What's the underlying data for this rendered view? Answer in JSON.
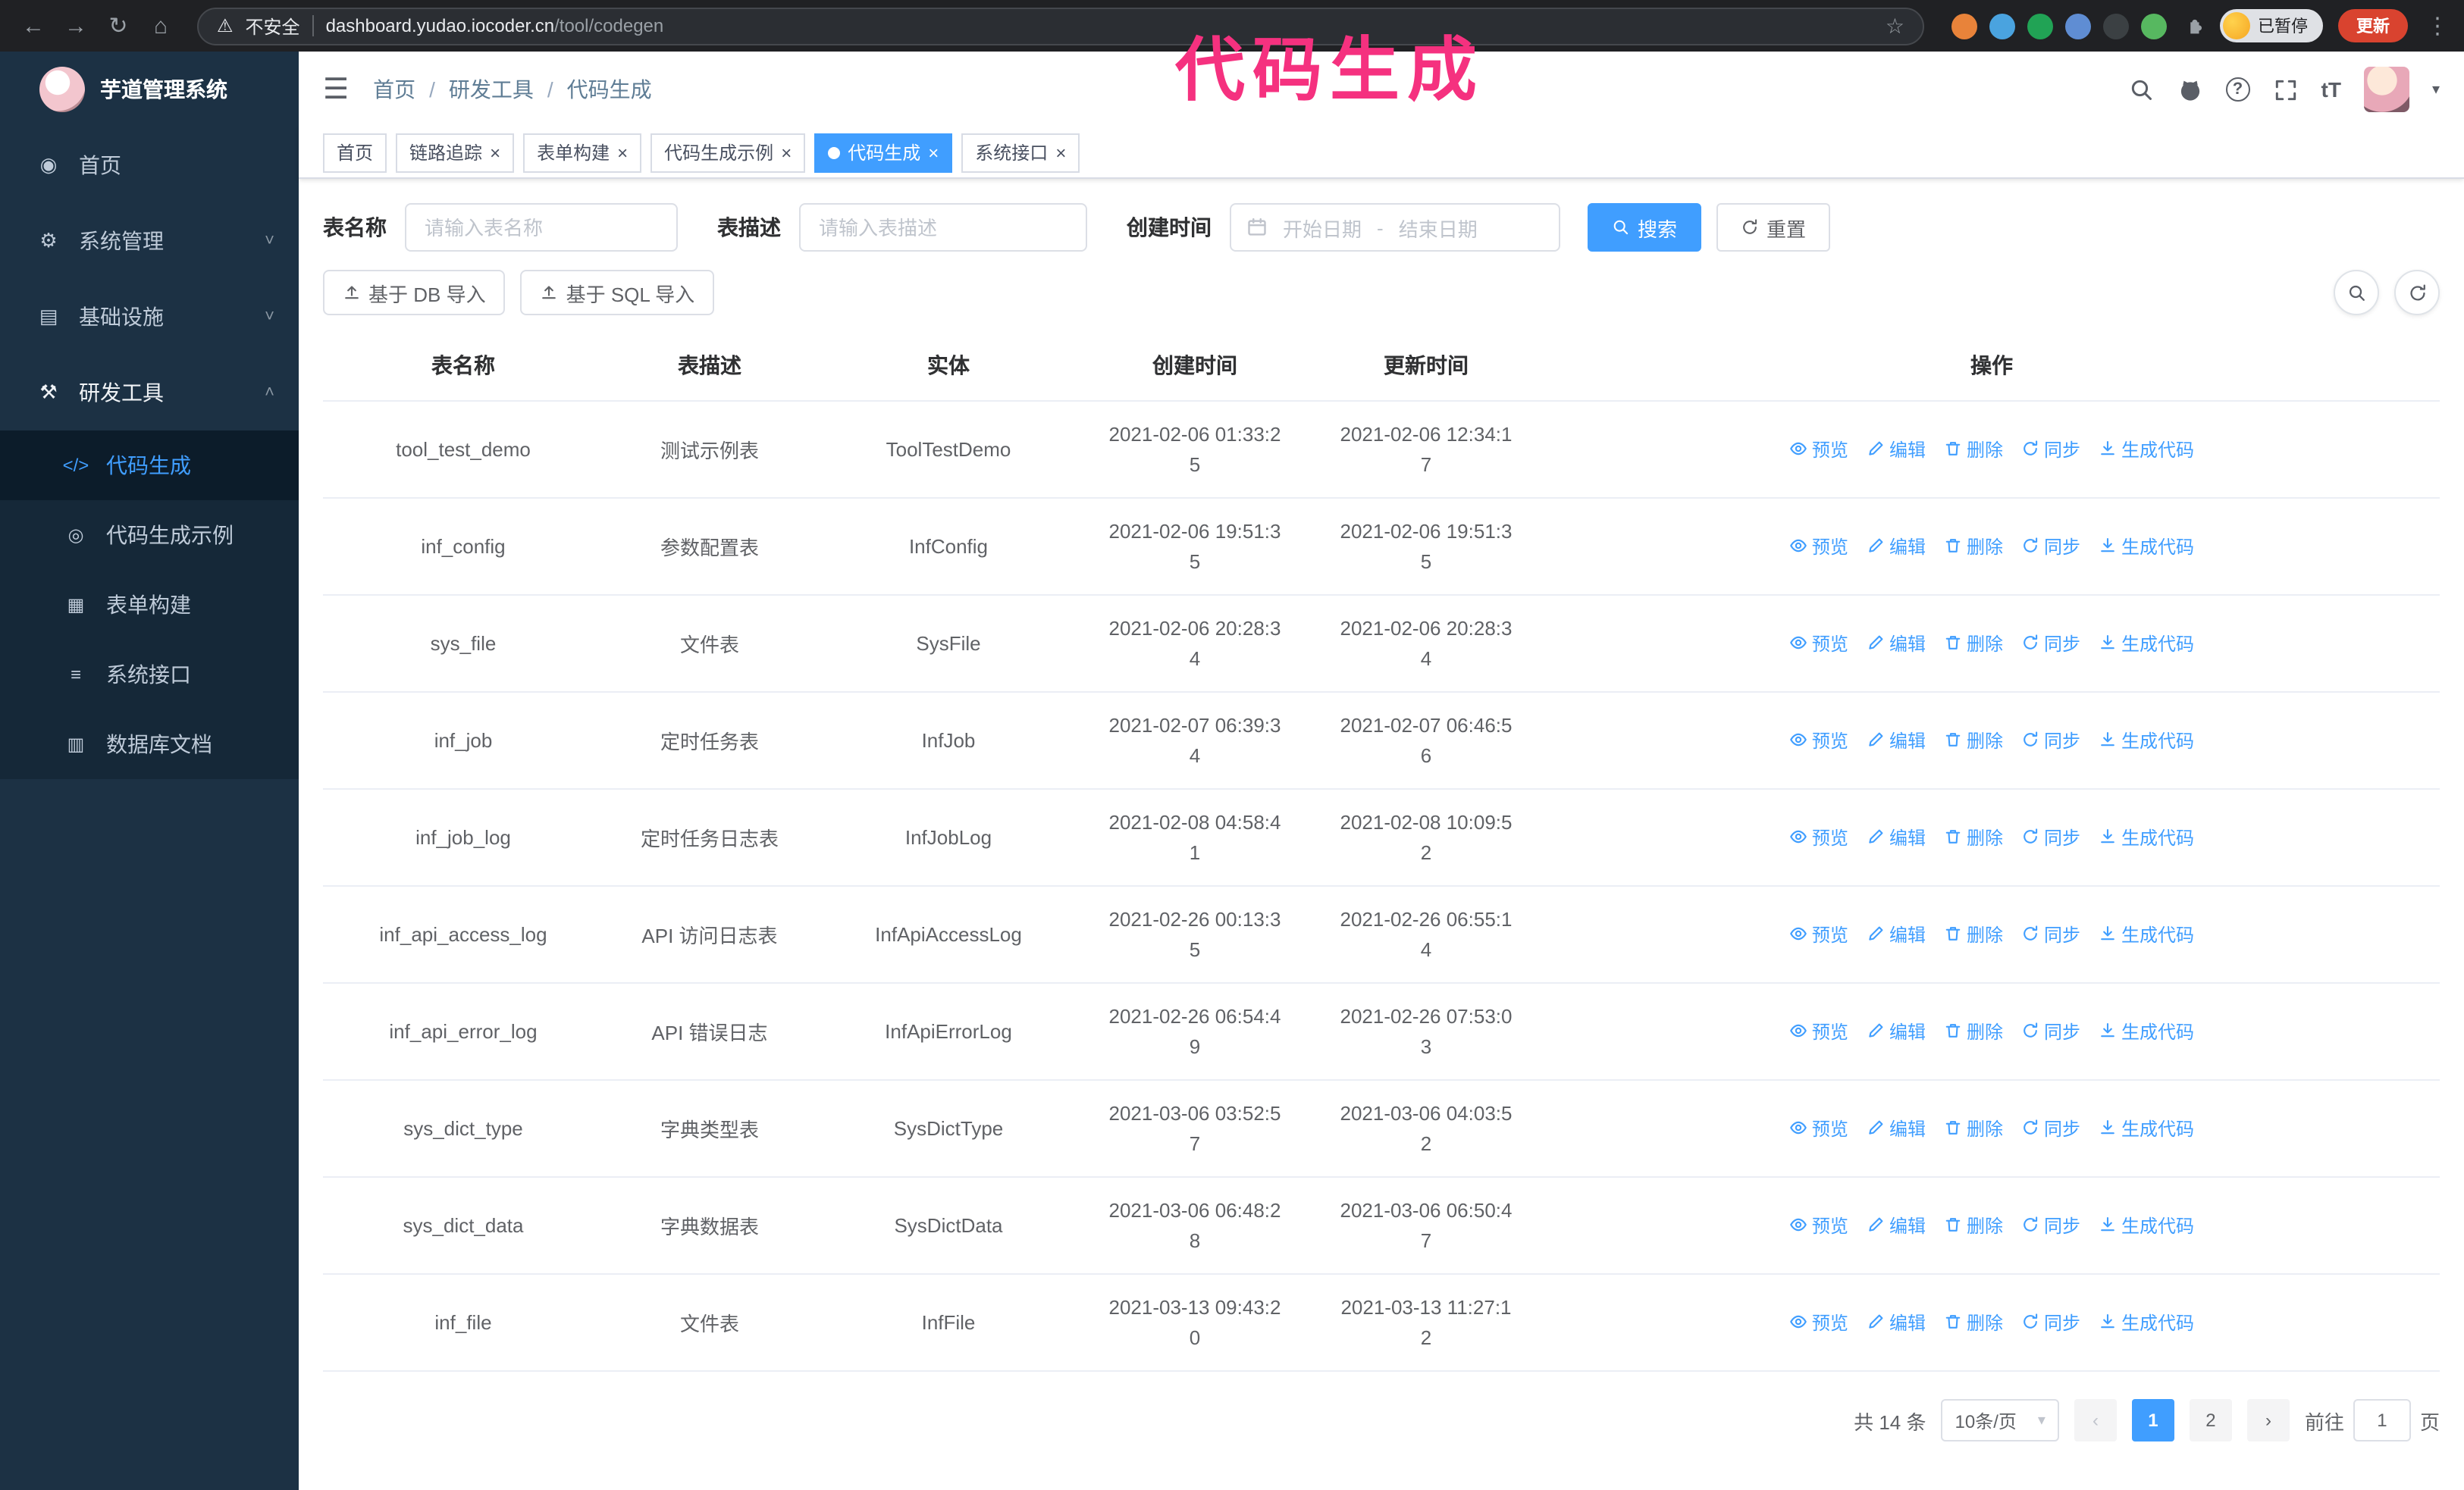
{
  "theme": {
    "accent": "#409eff",
    "sidebar_bg": "#1c3144",
    "submenu_bg": "#152838",
    "annotation_color": "#f5317f",
    "chrome_bg": "#202124"
  },
  "annotation": {
    "text": "代码生成",
    "color": "#f5317f"
  },
  "browser": {
    "nav_icons": [
      "back-arrow",
      "forward-arrow",
      "refresh",
      "home"
    ],
    "not_secure": "不安全",
    "url_host": "dashboard.yudao.iocoder.cn",
    "url_path": "/tool/codegen",
    "extension_colors": [
      "#e8833a",
      "#4aa3df",
      "#21a355",
      "#5f8dd3",
      "#3b4043",
      "#57b860"
    ],
    "paused_badge": "已暂停",
    "update_button": "更新"
  },
  "sidebar": {
    "logo_title": "芋道管理系统",
    "items": [
      {
        "label": "首页",
        "icon": "home"
      },
      {
        "label": "系统管理",
        "icon": "system",
        "expandable": true
      },
      {
        "label": "基础设施",
        "icon": "infra",
        "expandable": true
      },
      {
        "label": "研发工具",
        "icon": "tools",
        "expandable": true,
        "open": true,
        "children": [
          {
            "label": "代码生成",
            "icon": "code",
            "active": true
          },
          {
            "label": "代码生成示例",
            "icon": "example"
          },
          {
            "label": "表单构建",
            "icon": "form"
          },
          {
            "label": "系统接口",
            "icon": "api"
          },
          {
            "label": "数据库文档",
            "icon": "db"
          }
        ]
      }
    ]
  },
  "header": {
    "breadcrumb": [
      "首页",
      "研发工具",
      "代码生成"
    ],
    "tools": [
      {
        "name": "search"
      },
      {
        "name": "github"
      },
      {
        "name": "help"
      },
      {
        "name": "fullscreen"
      },
      {
        "name": "font-size"
      }
    ]
  },
  "tabs": [
    {
      "label": "首页",
      "closable": false,
      "active": false
    },
    {
      "label": "链路追踪",
      "closable": true,
      "active": false
    },
    {
      "label": "表单构建",
      "closable": true,
      "active": false
    },
    {
      "label": "代码生成示例",
      "closable": true,
      "active": false
    },
    {
      "label": "代码生成",
      "closable": true,
      "active": true
    },
    {
      "label": "系统接口",
      "closable": true,
      "active": false
    }
  ],
  "filters": {
    "table_name_label": "表名称",
    "table_name_placeholder": "请输入表名称",
    "table_desc_label": "表描述",
    "table_desc_placeholder": "请输入表描述",
    "create_time_label": "创建时间",
    "date_start_placeholder": "开始日期",
    "date_separator": "-",
    "date_end_placeholder": "结束日期",
    "search_label": "搜索",
    "reset_label": "重置"
  },
  "toolbar": {
    "import_db_label": "基于 DB 导入",
    "import_sql_label": "基于 SQL 导入"
  },
  "table": {
    "columns": [
      "表名称",
      "表描述",
      "实体",
      "创建时间",
      "更新时间",
      "操作"
    ],
    "actions": [
      "预览",
      "编辑",
      "删除",
      "同步",
      "生成代码"
    ],
    "rows": [
      {
        "name": "tool_test_demo",
        "desc": "测试示例表",
        "entity": "ToolTestDemo",
        "created": "2021-02-06 01:33:25",
        "updated": "2021-02-06 12:34:17"
      },
      {
        "name": "inf_config",
        "desc": "参数配置表",
        "entity": "InfConfig",
        "created": "2021-02-06 19:51:35",
        "updated": "2021-02-06 19:51:35"
      },
      {
        "name": "sys_file",
        "desc": "文件表",
        "entity": "SysFile",
        "created": "2021-02-06 20:28:34",
        "updated": "2021-02-06 20:28:34"
      },
      {
        "name": "inf_job",
        "desc": "定时任务表",
        "entity": "InfJob",
        "created": "2021-02-07 06:39:34",
        "updated": "2021-02-07 06:46:56"
      },
      {
        "name": "inf_job_log",
        "desc": "定时任务日志表",
        "entity": "InfJobLog",
        "created": "2021-02-08 04:58:41",
        "updated": "2021-02-08 10:09:52"
      },
      {
        "name": "inf_api_access_log",
        "desc": "API 访问日志表",
        "entity": "InfApiAccessLog",
        "created": "2021-02-26 00:13:35",
        "updated": "2021-02-26 06:55:14"
      },
      {
        "name": "inf_api_error_log",
        "desc": "API 错误日志",
        "entity": "InfApiErrorLog",
        "created": "2021-02-26 06:54:49",
        "updated": "2021-02-26 07:53:03"
      },
      {
        "name": "sys_dict_type",
        "desc": "字典类型表",
        "entity": "SysDictType",
        "created": "2021-03-06 03:52:57",
        "updated": "2021-03-06 04:03:52"
      },
      {
        "name": "sys_dict_data",
        "desc": "字典数据表",
        "entity": "SysDictData",
        "created": "2021-03-06 06:48:28",
        "updated": "2021-03-06 06:50:47"
      },
      {
        "name": "inf_file",
        "desc": "文件表",
        "entity": "InfFile",
        "created": "2021-03-13 09:43:20",
        "updated": "2021-03-13 11:27:12"
      }
    ]
  },
  "pagination": {
    "total_text": "共 14 条",
    "page_size_text": "10条/页",
    "pages": [
      "1",
      "2"
    ],
    "active_page": "1",
    "goto_label": "前往",
    "goto_value": "1",
    "goto_suffix_label": "页"
  }
}
